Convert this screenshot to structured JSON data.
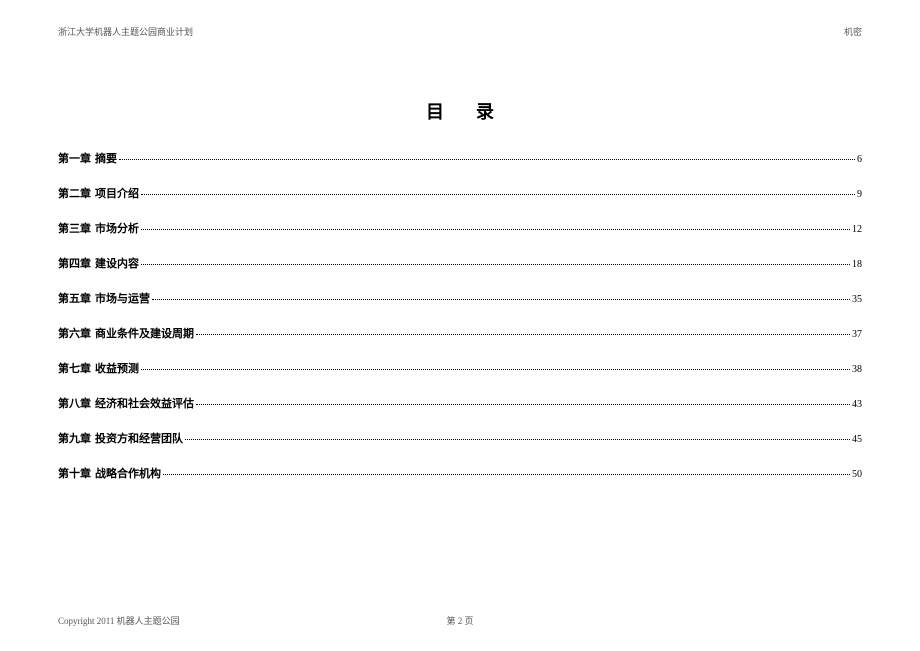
{
  "header": {
    "left": "浙江大学机器人主题公园商业计划",
    "right": "机密"
  },
  "title": "目录",
  "toc": [
    {
      "chapter": "第一章",
      "title": "摘要",
      "page": "6"
    },
    {
      "chapter": "第二章",
      "title": "项目介绍",
      "page": "9"
    },
    {
      "chapter": "第三章",
      "title": "市场分析",
      "page": "12"
    },
    {
      "chapter": "第四章",
      "title": "建设内容",
      "page": "18"
    },
    {
      "chapter": "第五章",
      "title": "市场与运营",
      "page": "35"
    },
    {
      "chapter": "第六章",
      "title": "商业条件及建设周期",
      "page": "37"
    },
    {
      "chapter": "第七章",
      "title": "收益预测",
      "page": "38"
    },
    {
      "chapter": "第八章",
      "title": "经济和社会效益评估",
      "page": "43"
    },
    {
      "chapter": "第九章",
      "title": "投资方和经营团队",
      "page": "45"
    },
    {
      "chapter": "第十章",
      "title": "战略合作机构",
      "page": "50"
    }
  ],
  "footer": {
    "left": "Copyright 2011 机器人主题公园",
    "center": "第 2 页"
  }
}
